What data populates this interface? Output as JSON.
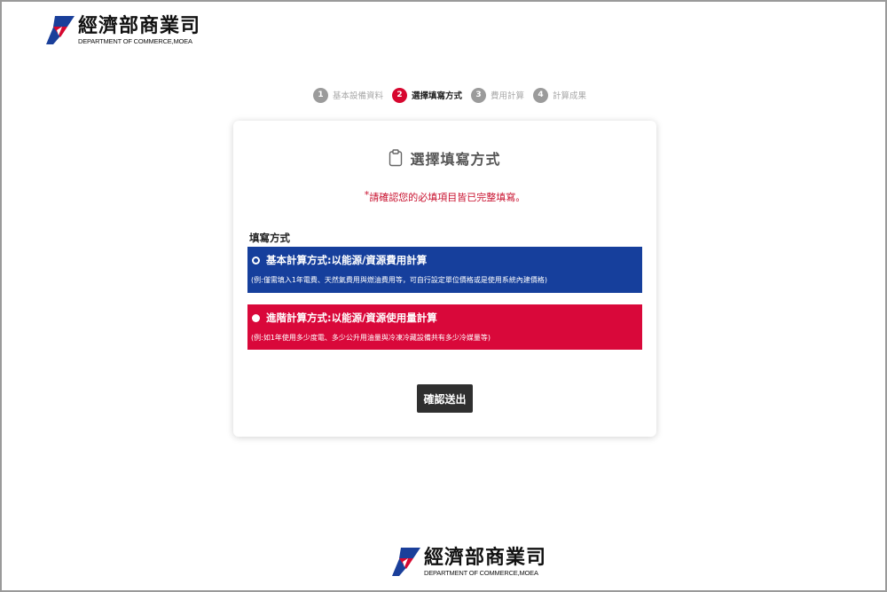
{
  "header": {
    "logo_zh": "經濟部商業司",
    "logo_en": "DEPARTMENT OF COMMERCE,MOEA"
  },
  "stepper": {
    "steps": [
      {
        "num": "1",
        "label": "基本設備資料",
        "active": false
      },
      {
        "num": "2",
        "label": "選擇填寫方式",
        "active": true
      },
      {
        "num": "3",
        "label": "費用計算",
        "active": false
      },
      {
        "num": "4",
        "label": "計算成果",
        "active": false
      }
    ]
  },
  "card": {
    "title": "選擇填寫方式",
    "warning_star": "*",
    "warning": "請確認您的必填項目皆已完整填寫。",
    "section_label": "填寫方式",
    "options": [
      {
        "title": "基本計算方式:以能源/資源費用計算",
        "desc": "(例:僅需填入1年電費、天然氣費用與燃油費用等，可自行設定單位價格或是使用系統內建價格)",
        "selected": true
      },
      {
        "title": "進階計算方式:以能源/資源使用量計算",
        "desc": "(例:如1年使用多少度電、多少公升用油量與冷凍冷藏設備共有多少冷媒量等)",
        "selected": false
      }
    ],
    "submit_label": "確認送出"
  },
  "footer": {
    "logo_zh": "經濟部商業司",
    "logo_en": "DEPARTMENT OF COMMERCE,MOEA"
  },
  "colors": {
    "brand_red": "#d7072f",
    "option_blue": "#163f9c",
    "option_red": "#d9083a",
    "button_dark": "#2f2f2f"
  }
}
